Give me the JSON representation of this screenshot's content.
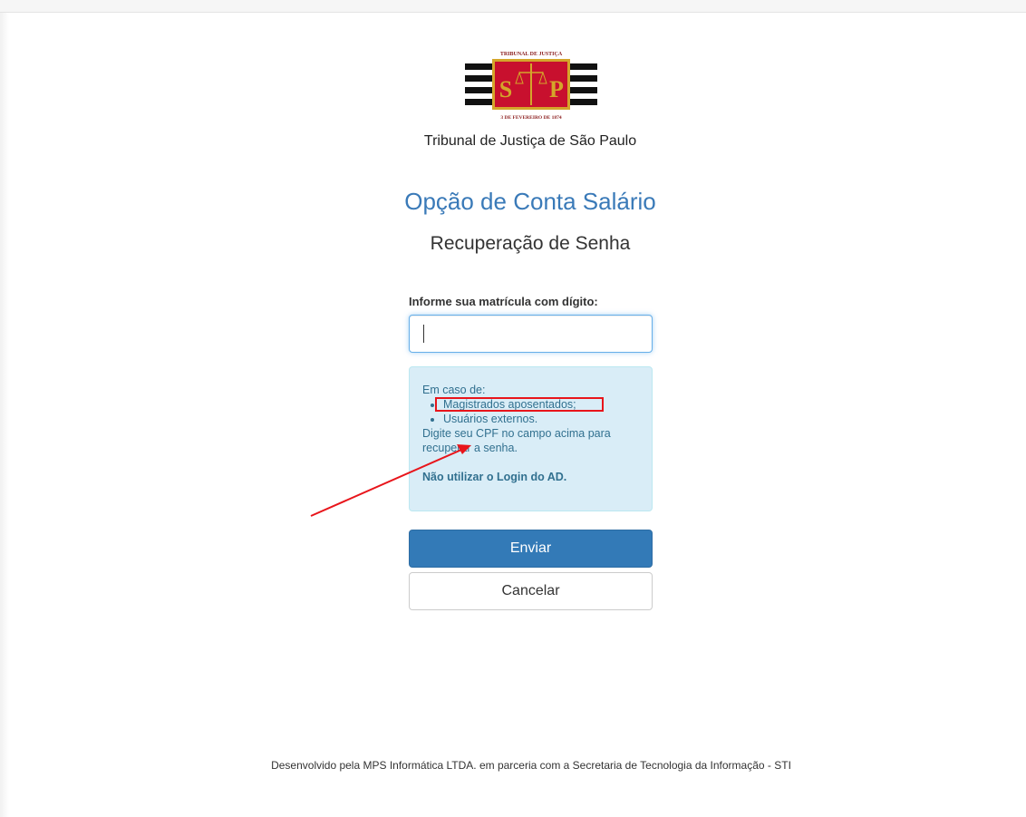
{
  "logo": {
    "top_text": "TRIBUNAL DE JUSTIÇA",
    "letters_left": "S",
    "letters_right": "P",
    "bottom_text": "3 DE FEVEREIRO DE 1874",
    "colors": {
      "red": "#c8102e",
      "gold": "#d4a62a",
      "black": "#111111"
    }
  },
  "header": {
    "court_name": "Tribunal de Justiça de São Paulo",
    "title": "Opção de Conta Salário",
    "subtitle": "Recuperação de Senha"
  },
  "form": {
    "label": "Informe sua matrícula com dígito:",
    "value": "",
    "placeholder": ""
  },
  "info": {
    "intro": "Em caso de:",
    "items": [
      "Magistrados aposentados;",
      "Usuários externos."
    ],
    "instruction": "Digite seu CPF no campo acima para recuperar a senha.",
    "warning": "Não utilizar o Login do AD."
  },
  "buttons": {
    "submit": "Enviar",
    "cancel": "Cancelar"
  },
  "footer": {
    "text": "Desenvolvido pela MPS Informática LTDA. em parceria com a Secretaria de Tecnologia da Informação - STI"
  },
  "annotation_color": "#e8151b"
}
